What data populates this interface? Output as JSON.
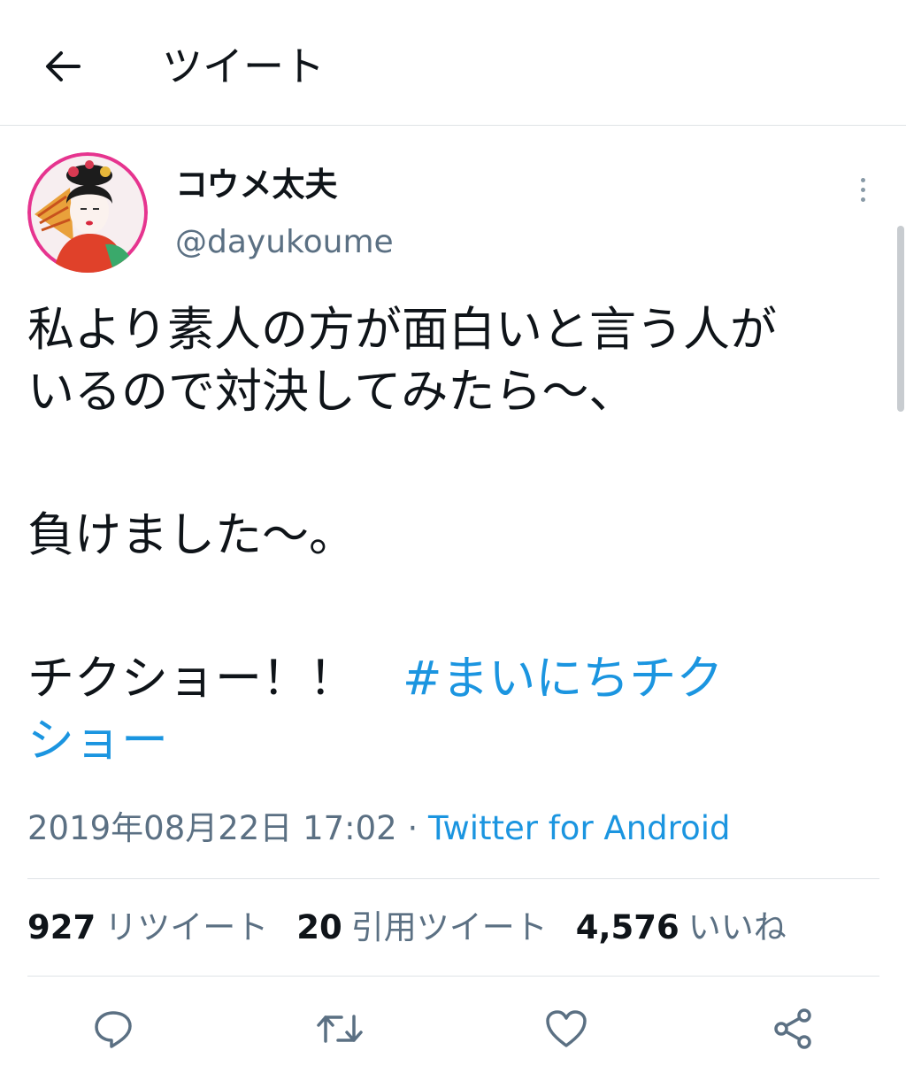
{
  "header": {
    "title": "ツイート",
    "back_icon": "arrow-left-icon"
  },
  "author": {
    "display_name": "コウメ太夫",
    "handle": "@dayukoume",
    "avatar_icon": "avatar-photo"
  },
  "tweet": {
    "lines": [
      "私より素人の方が面白いと言う人が",
      "いるので対決してみたら〜、",
      "",
      "負けました〜。",
      "",
      "チクショー！！　"
    ],
    "hashtag_part1": "#まいにちチク",
    "hashtag_part2": "ショー",
    "timestamp": "2019年08月22日 17:02",
    "separator": " · ",
    "source": "Twitter for Android"
  },
  "stats": {
    "retweets": {
      "count": "927",
      "label": "リツイート"
    },
    "quotes": {
      "count": "20",
      "label": "引用ツイート"
    },
    "likes": {
      "count": "4,576",
      "label": "いいね"
    }
  },
  "actions": {
    "reply_icon": "reply-icon",
    "retweet_icon": "retweet-icon",
    "like_icon": "heart-icon",
    "share_icon": "share-icon"
  },
  "colors": {
    "link": "#1b95e0",
    "secondary_text": "#5b7083",
    "primary_text": "#0f1419",
    "divider": "#dfe3e6"
  }
}
